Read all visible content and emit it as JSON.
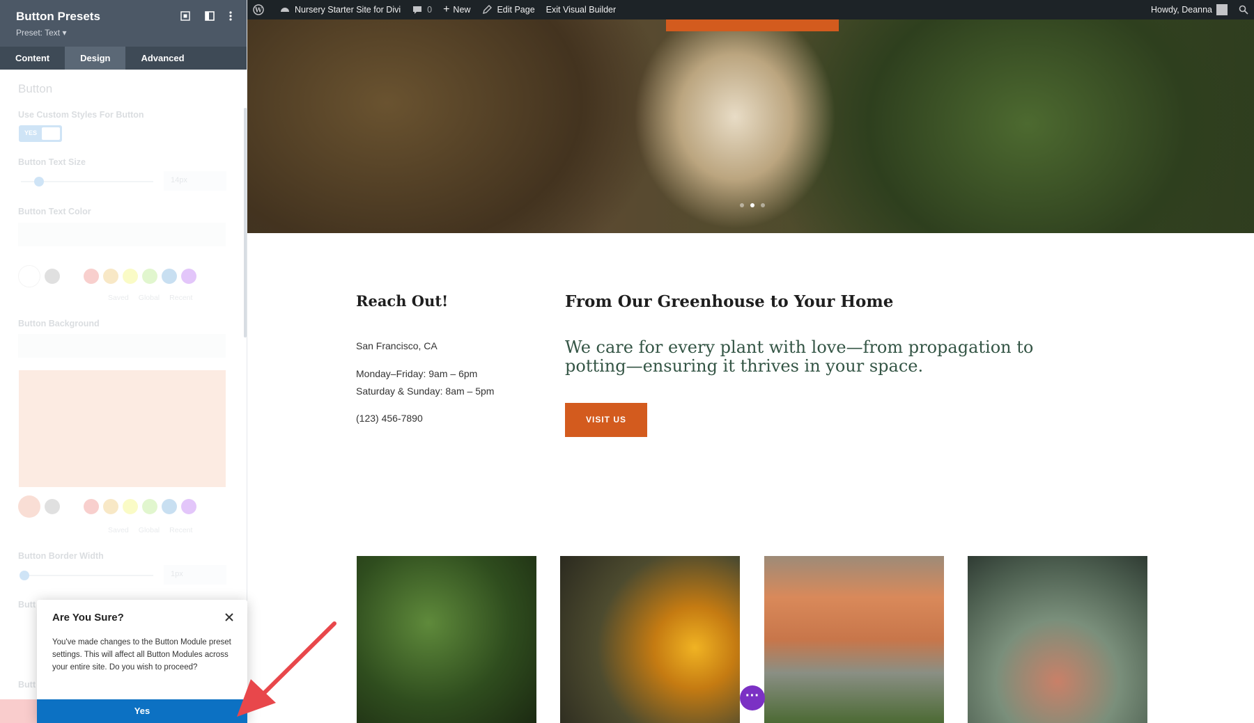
{
  "admin_bar": {
    "site_name": "Nursery Starter Site for Divi",
    "comments_count": "0",
    "new_label": "New",
    "edit_page_label": "Edit Page",
    "exit_builder_label": "Exit Visual Builder",
    "greeting": "Howdy, Deanna"
  },
  "panel": {
    "title": "Button Presets",
    "preset": "Preset: Text ▾",
    "tabs": [
      {
        "label": "Content",
        "active": false
      },
      {
        "label": "Design",
        "active": true
      },
      {
        "label": "Advanced",
        "active": false
      }
    ],
    "section_title": "Button",
    "fields": {
      "use_custom_styles": "Use Custom Styles For Button",
      "toggle_value": "YES",
      "text_size": "Button Text Size",
      "text_size_value": "14px",
      "text_color": "Button Text Color",
      "background": "Button Background",
      "border_width": "Button Border Width",
      "border_width_value": "1px",
      "truncated_1": "Butt",
      "truncated_2": "Butt"
    },
    "palette_tabs": [
      "Saved",
      "Global",
      "Recent"
    ],
    "background_color": "#f3a97f"
  },
  "dialog": {
    "title": "Are You Sure?",
    "message": "You've made changes to the Button Module preset settings. This will affect all Button Modules across your entire site. Do you wish to proceed?",
    "confirm_label": "Yes"
  },
  "page": {
    "reach_title": "Reach Out!",
    "location": "San Francisco, CA",
    "hours_weekday": "Monday–Friday: 9am – 6pm",
    "hours_weekend": "Saturday & Sunday: 8am – 5pm",
    "phone": "(123) 456-7890",
    "section_title": "From Our Greenhouse to Your Home",
    "tagline": "We care for every plant with love—from propagation to potting—ensuring it thrives in your space.",
    "visit_button": "VISIT US",
    "accent_color": "#d35b1e",
    "slider_dots": 3,
    "active_dot": 2
  }
}
